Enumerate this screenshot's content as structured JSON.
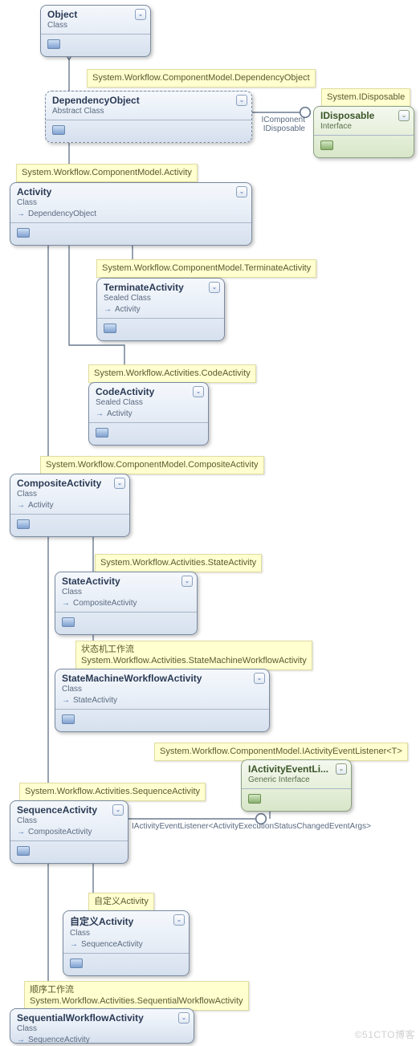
{
  "notes": {
    "n1": "System.Workflow.ComponentModel.DependencyObject",
    "n2": "System.IDisposable",
    "n3": "System.Workflow.ComponentModel.Activity",
    "n4": "System.Workflow.ComponentModel.TerminateActivity",
    "n5": "System.Workflow.Activities.CodeActivity",
    "n6": "System.Workflow.ComponentModel.CompositeActivity",
    "n7": "System.Workflow.Activities.StateActivity",
    "n8a": "状态机工作流",
    "n8b": "System.Workflow.Activities.StateMachineWorkflowActivity",
    "n9": "System.Workflow.ComponentModel.IActivityEventListener<T>",
    "n10": "System.Workflow.Activities.SequenceActivity",
    "n11": "自定义Activity",
    "n12a": "顺序工作流",
    "n12b": "System.Workflow.Activities.SequentialWorkflowActivity"
  },
  "classes": {
    "object": {
      "title": "Object",
      "kind": "Class"
    },
    "dependencyObject": {
      "title": "DependencyObject",
      "kind": "Abstract Class"
    },
    "idisposable": {
      "title": "IDisposable",
      "kind": "Interface"
    },
    "activity": {
      "title": "Activity",
      "kind": "Class",
      "inherits": "DependencyObject"
    },
    "terminate": {
      "title": "TerminateActivity",
      "kind": "Sealed Class",
      "inherits": "Activity"
    },
    "code": {
      "title": "CodeActivity",
      "kind": "Sealed Class",
      "inherits": "Activity"
    },
    "composite": {
      "title": "CompositeActivity",
      "kind": "Class",
      "inherits": "Activity"
    },
    "state": {
      "title": "StateActivity",
      "kind": "Class",
      "inherits": "CompositeActivity"
    },
    "statemachine": {
      "title": "StateMachineWorkflowActivity",
      "kind": "Class",
      "inherits": "StateActivity"
    },
    "ievent": {
      "title": "IActivityEventLi...",
      "kind": "Generic Interface"
    },
    "sequence": {
      "title": "SequenceActivity",
      "kind": "Class",
      "inherits": "CompositeActivity"
    },
    "custom": {
      "title": "自定义Activity",
      "kind": "Class",
      "inherits": "SequenceActivity"
    },
    "sequential": {
      "title": "SequentialWorkflowActivity",
      "kind": "Class",
      "inherits": "SequenceActivity"
    }
  },
  "iface_labels": {
    "icomponent": "IComponent",
    "idisposable": "IDisposable",
    "listener_long": "IActivityEventListener<ActivityExecutionStatusChangedEventArgs>"
  },
  "watermark": "©51CTO博客"
}
